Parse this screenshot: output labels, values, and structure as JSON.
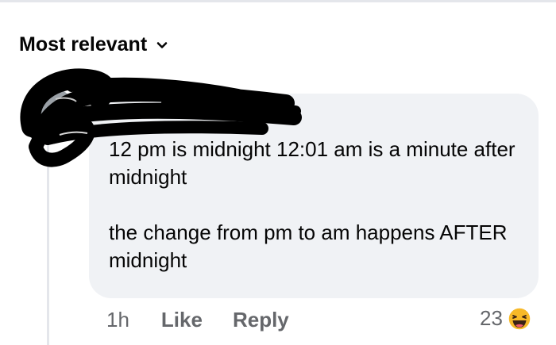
{
  "header": {
    "sort_label": "Most relevant"
  },
  "comment": {
    "author": "",
    "paragraphs": [
      "12 pm is midnight 12:01 am is a minute after midnight",
      "the change from pm to am happens AFTER midnight"
    ],
    "time": "1h",
    "like_label": "Like",
    "reply_label": "Reply",
    "reaction_count": "23",
    "reaction_icon": "haha-emoji-icon"
  },
  "colors": {
    "bubble": "#f0f2f5",
    "text": "#050505",
    "secondary": "#65676b",
    "redaction": "#000000"
  }
}
